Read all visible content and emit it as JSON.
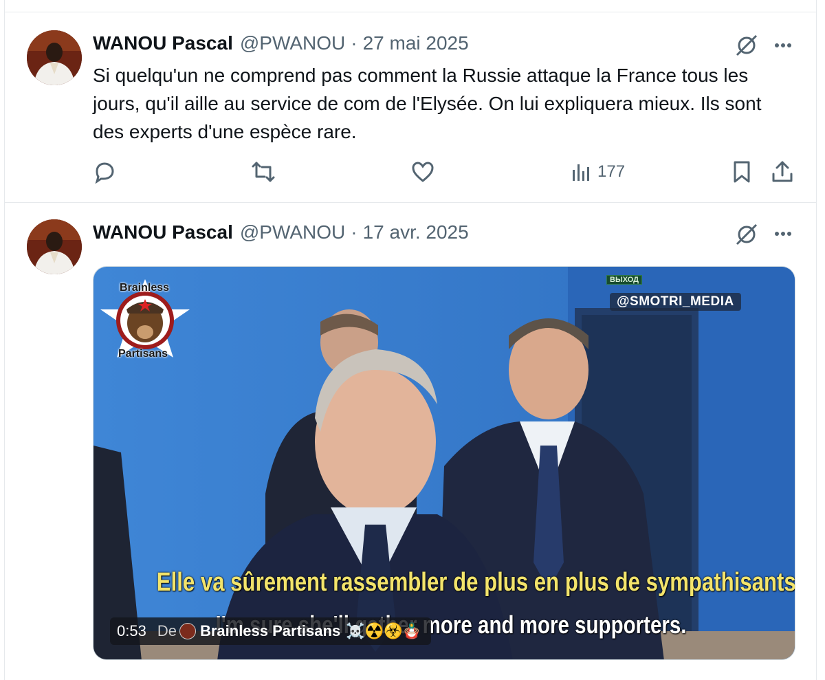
{
  "tweets": [
    {
      "author_name": "WANOU Pascal",
      "handle": "@PWANOU",
      "separator": "·",
      "date": "27 mai 2025",
      "text": "Si quelqu'un ne comprend pas comment la Russie attaque la France tous les jours, qu'il aille au service de com de l'Elysée. On lui expliquera mieux. Ils sont des experts d'une espèce rare.",
      "actions": {
        "views": "177"
      }
    },
    {
      "author_name": "WANOU Pascal",
      "handle": "@PWANOU",
      "separator": "·",
      "date": "17 avr. 2025",
      "media": {
        "type": "video",
        "logo_top": "Brainless",
        "logo_bottom": "Partisans",
        "watermark": "@SMOTRI_MEDIA",
        "exit_sign": "ВЫХОД",
        "subtitle_fr": "Elle va sûrement rassembler de plus en plus de sympathisants.",
        "subtitle_en": "I'm sure she'll gather more and more supporters.",
        "duration": "0:53",
        "from_label": "De",
        "channel_name": "Brainless Partisans",
        "channel_emojis": "☠️☢️☣️🪆"
      }
    }
  ],
  "colors": {
    "text_primary": "#0f1419",
    "text_secondary": "#536471",
    "border": "#e6e9ec",
    "video_bg": "#3d7fd1",
    "subtitle_yellow": "#f3e46b"
  },
  "icons": [
    "reply-icon",
    "retweet-icon",
    "like-icon",
    "views-icon",
    "bookmark-icon",
    "share-icon",
    "grok-icon",
    "more-icon"
  ]
}
